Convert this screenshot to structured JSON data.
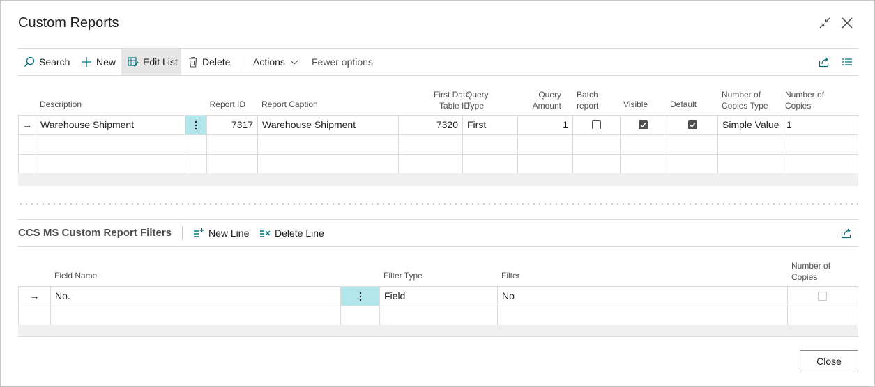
{
  "window": {
    "title": "Custom Reports",
    "collapse_icon": "collapse-icon",
    "close_icon": "close-icon"
  },
  "toolbar": {
    "search": "Search",
    "new": "New",
    "edit_list": "Edit List",
    "delete": "Delete",
    "actions": "Actions",
    "fewer_options": "Fewer options"
  },
  "reports": {
    "headers": {
      "description": "Description",
      "report_id": "Report ID",
      "report_caption": "Report Caption",
      "first_data_1": "First Data",
      "first_data_2": "Table ID",
      "query_type_1": "Query",
      "query_type_2": "Type",
      "query_amount_1": "Query",
      "query_amount_2": "Amount",
      "batch_1": "Batch",
      "batch_2": "report",
      "visible": "Visible",
      "default": "Default",
      "copies_type_1": "Number of",
      "copies_type_2": "Copies Type",
      "copies_1": "Number of",
      "copies_2": "Copies"
    },
    "rows": [
      {
        "indicator": "→",
        "description": "Warehouse Shipment",
        "report_id": "7317",
        "report_caption": "Warehouse Shipment",
        "first_data_table_id": "7320",
        "query_type": "First",
        "query_amount": "1",
        "batch_report": false,
        "visible": true,
        "default": true,
        "copies_type": "Simple Value",
        "copies": "1"
      }
    ]
  },
  "filters": {
    "title": "CCS MS Custom Report Filters",
    "new_line": "New Line",
    "delete_line": "Delete Line",
    "headers": {
      "field_name": "Field Name",
      "filter_type": "Filter Type",
      "filter": "Filter",
      "copies_1": "Number of",
      "copies_2": "Copies"
    },
    "rows": [
      {
        "indicator": "→",
        "field_name": "No.",
        "filter_type": "Field",
        "filter": "No",
        "number_of_copies": false
      }
    ]
  },
  "footer": {
    "close": "Close"
  },
  "colors": {
    "accent": "#00707a",
    "selected_cell": "#b3e6ea"
  }
}
